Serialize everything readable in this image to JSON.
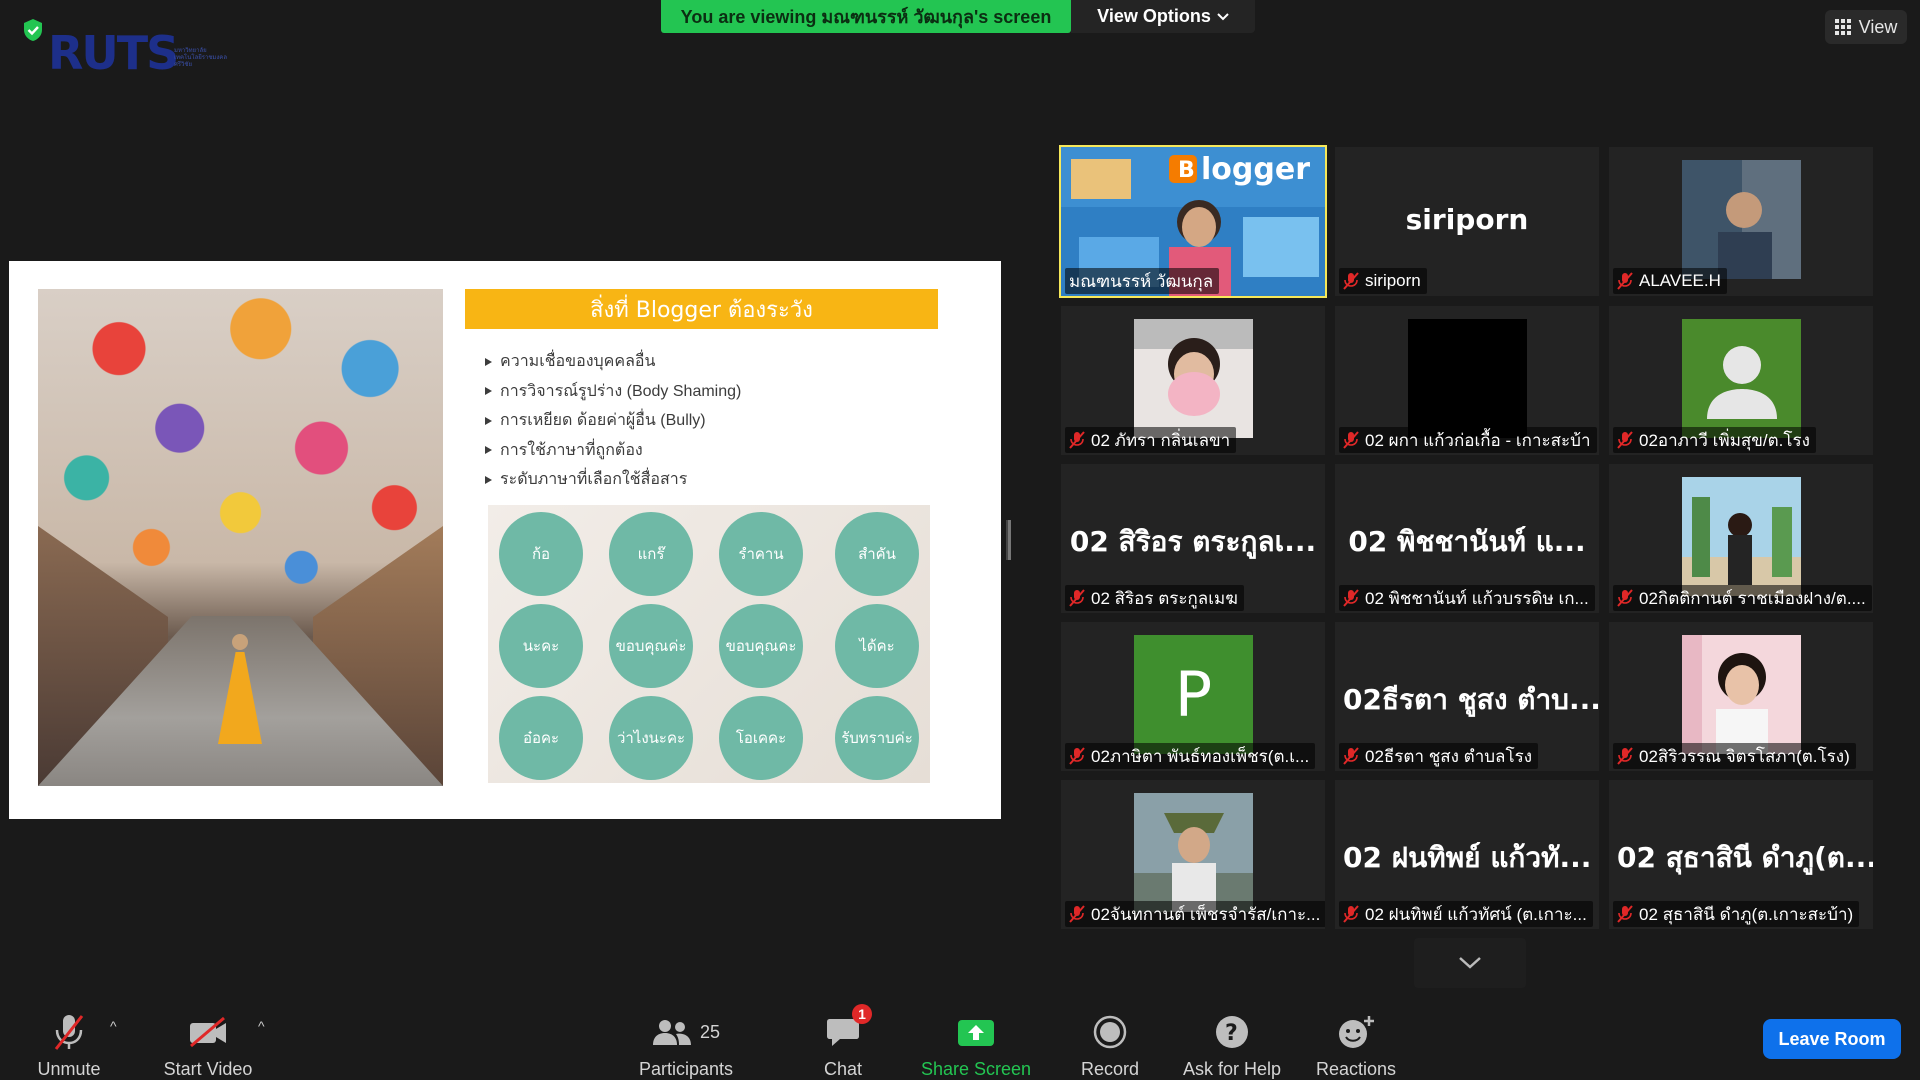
{
  "top": {
    "logo_text": "RUTS",
    "logo_subtext": "มหาวิทยาลัยเทคโนโลยีราชมงคลศรีวิชัย",
    "viewing_banner": "You are viewing มณฑนรรห์ วัฒนกุล's screen",
    "view_options_label": "View Options",
    "view_label": "View"
  },
  "slide": {
    "title": "สิ่งที่ Blogger ต้องระวัง",
    "bullets": [
      "ความเชื่อของบุคคลอื่น",
      "การวิจารณ์รูปร่าง (Body Shaming)",
      "การเหยียด ด้อยค่าผู้อื่น (Bully)",
      "การใช้ภาษาที่ถูกต้อง",
      "ระดับภาษาที่เลือกใช้สื่อสาร"
    ],
    "circles": [
      "ก้อ",
      "แกร๊",
      "รำคาน",
      "สำคัน",
      "นะคะ",
      "ขอบคุณค่ะ",
      "ขอบคุณคะ",
      "ได้คะ",
      "อ๋อคะ",
      "ว่าไงนะคะ",
      "โอเคคะ",
      "รับทราบค่ะ"
    ],
    "circle_color": "#6fb9a6",
    "title_color": "#f8b514"
  },
  "gallery": {
    "tiles": [
      {
        "label": "มณฑนรรห์ วัฒนกุล",
        "big": "",
        "muted": false
      },
      {
        "label": "siriporn",
        "big": "siriporn",
        "muted": true
      },
      {
        "label": "ALAVEE.H",
        "big": "",
        "muted": true
      },
      {
        "label": "02 ภัทรา กลิ่นเลขา",
        "big": "",
        "muted": true
      },
      {
        "label": "02 ผกา แก้วก่อเกื้อ - เกาะสะบ้า",
        "big": "",
        "muted": true
      },
      {
        "label": "02อาภาวี เพิ่มสุข/ต.โรง",
        "big": "",
        "muted": true
      },
      {
        "label": "02 สิริอร ตระกูลเมฆ",
        "big": "02 สิริอร ตระกูลเ...",
        "muted": true
      },
      {
        "label": "02 พิชชานันท์ แก้วบรรดิษ เก...",
        "big": "02 พิชชานันท์ แ...",
        "muted": true
      },
      {
        "label": "02กิตติกานต์ ราชเมืองฝาง/ต....",
        "big": "",
        "muted": true
      },
      {
        "label": "02ภาษิตา พันธ์ทองเพ็ชร(ต.เ...",
        "big": "",
        "muted": true,
        "letter": "P"
      },
      {
        "label": "02ธีรตา ชูสง ตำบลโรง",
        "big": "02ธีรตา ชูสง ตำบ...",
        "muted": true
      },
      {
        "label": "02สิริวรรณ จิตรโสภา(ต.โรง)",
        "big": "",
        "muted": true
      },
      {
        "label": "02จันทกานต์ เพ็ชรจำรัส/เกาะ...",
        "big": "",
        "muted": true
      },
      {
        "label": "02 ฝนทิพย์ แก้วทัศน์ (ต.เกาะ...",
        "big": "02 ฝนทิพย์ แก้วทั...",
        "muted": true
      },
      {
        "label": "02 สุธาสินี ดำภู(ต.เกาะสะบ้า)",
        "big": "02 สุธาสินี ดำภู(ต...",
        "muted": true
      }
    ]
  },
  "toolbar": {
    "unmute": "Unmute",
    "start_video": "Start Video",
    "participants": "Participants",
    "participants_count": "25",
    "chat": "Chat",
    "chat_badge": "1",
    "share_screen": "Share Screen",
    "record": "Record",
    "ask_help": "Ask for Help",
    "reactions": "Reactions",
    "leave": "Leave Room",
    "share_color": "#23c552",
    "leave_color": "#0e71eb"
  }
}
